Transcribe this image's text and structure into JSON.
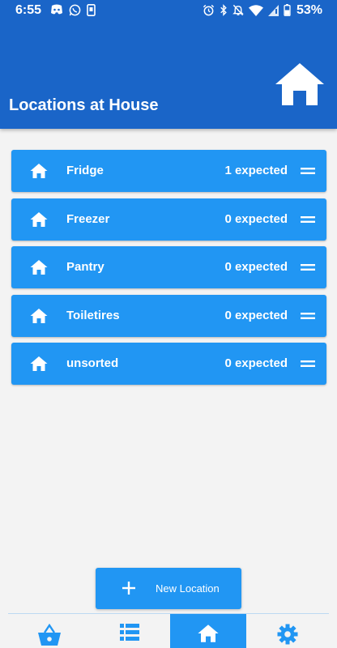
{
  "status_bar": {
    "time": "6:55",
    "battery": "53%",
    "left_icons": [
      "discord-icon",
      "whatsapp-icon",
      "phone-icon"
    ],
    "right_icons": [
      "alarm-icon",
      "bluetooth-icon",
      "mute-icon",
      "wifi-icon",
      "signal-icon",
      "battery-icon"
    ]
  },
  "header": {
    "title": "Locations at House",
    "icon": "house-icon"
  },
  "locations": [
    {
      "name": "Fridge",
      "expected": "1 expected"
    },
    {
      "name": "Freezer",
      "expected": "0 expected"
    },
    {
      "name": "Pantry",
      "expected": "0 expected"
    },
    {
      "name": "Toiletires",
      "expected": "0 expected"
    },
    {
      "name": "unsorted",
      "expected": "0 expected"
    }
  ],
  "new_location_button": {
    "label": "New Location",
    "icon": "plus-icon"
  },
  "bottom_nav": [
    {
      "icon": "basket-icon",
      "active": false
    },
    {
      "icon": "list-icon",
      "active": false
    },
    {
      "icon": "house-icon",
      "active": true
    },
    {
      "icon": "gear-icon",
      "active": false
    }
  ],
  "colors": {
    "header": "#1a65c8",
    "accent": "#2196f3",
    "background": "#f3f3f3"
  }
}
